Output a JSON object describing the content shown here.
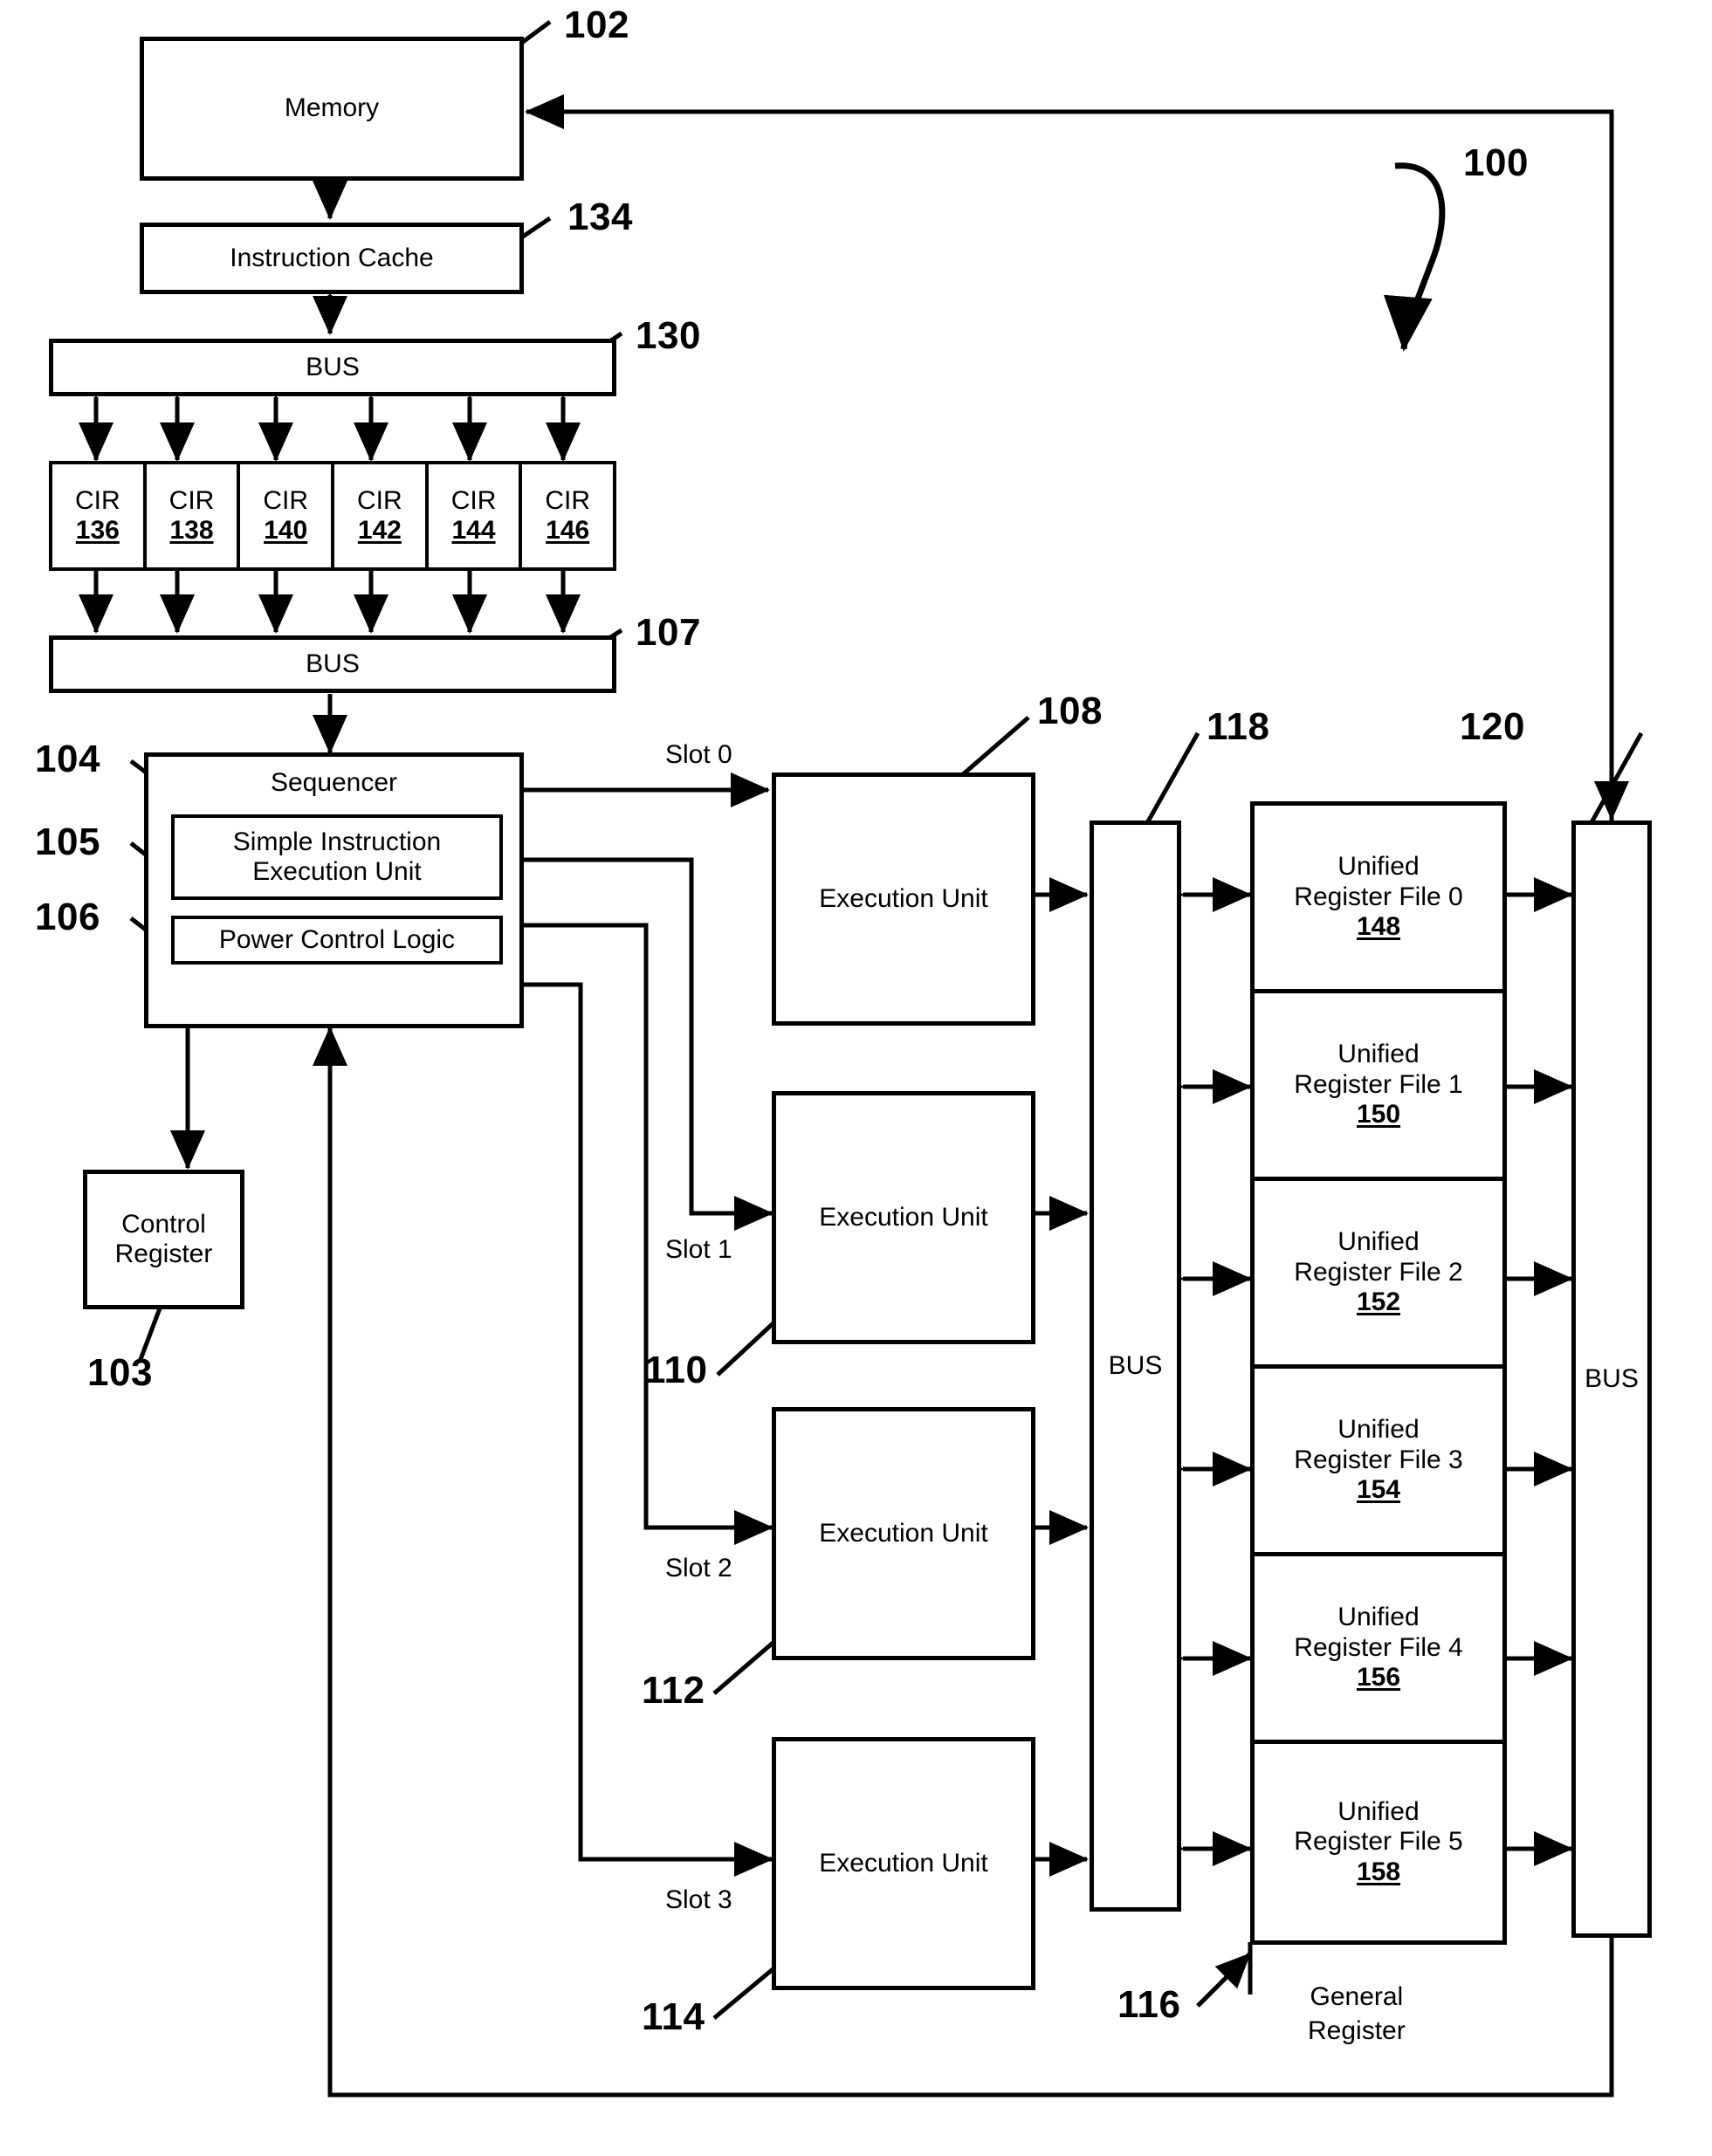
{
  "figure": {
    "system_ref": "100",
    "blocks": {
      "memory": {
        "label": "Memory",
        "ref": "102"
      },
      "instruction_cache": {
        "label": "Instruction Cache",
        "ref": "134"
      },
      "bus_top": {
        "label": "BUS",
        "ref": "130"
      },
      "bus_mid": {
        "label": "BUS",
        "ref": "107"
      },
      "sequencer": {
        "label": "Sequencer",
        "ref": "104"
      },
      "simple_instruction_execution_unit": {
        "label": "Simple Instruction Execution Unit",
        "ref": "105"
      },
      "power_control_logic": {
        "label": "Power Control Logic",
        "ref": "106"
      },
      "control_register": {
        "label": "Control Register",
        "ref": "103"
      },
      "bus_register": {
        "label": "BUS",
        "ref": "118"
      },
      "bus_right": {
        "label": "BUS",
        "ref": "120"
      },
      "general_register": {
        "label": "General Register",
        "ref": "116"
      }
    },
    "cir_registers": [
      {
        "label": "CIR",
        "ref": "136"
      },
      {
        "label": "CIR",
        "ref": "138"
      },
      {
        "label": "CIR",
        "ref": "140"
      },
      {
        "label": "CIR",
        "ref": "142"
      },
      {
        "label": "CIR",
        "ref": "144"
      },
      {
        "label": "CIR",
        "ref": "146"
      }
    ],
    "execution_units": [
      {
        "label": "Execution Unit",
        "ref": "108",
        "slot": "Slot 0"
      },
      {
        "label": "Execution Unit",
        "ref": "110",
        "slot": "Slot 1"
      },
      {
        "label": "Execution Unit",
        "ref": "112",
        "slot": "Slot 2"
      },
      {
        "label": "Execution Unit",
        "ref": "114",
        "slot": "Slot 3"
      }
    ],
    "register_files": [
      {
        "name": "Unified Register File 0",
        "ref": "148"
      },
      {
        "name": "Unified Register File 1",
        "ref": "150"
      },
      {
        "name": "Unified Register File 2",
        "ref": "152"
      },
      {
        "name": "Unified Register File 3",
        "ref": "154"
      },
      {
        "name": "Unified Register File 4",
        "ref": "156"
      },
      {
        "name": "Unified Register File 5",
        "ref": "158"
      }
    ]
  }
}
